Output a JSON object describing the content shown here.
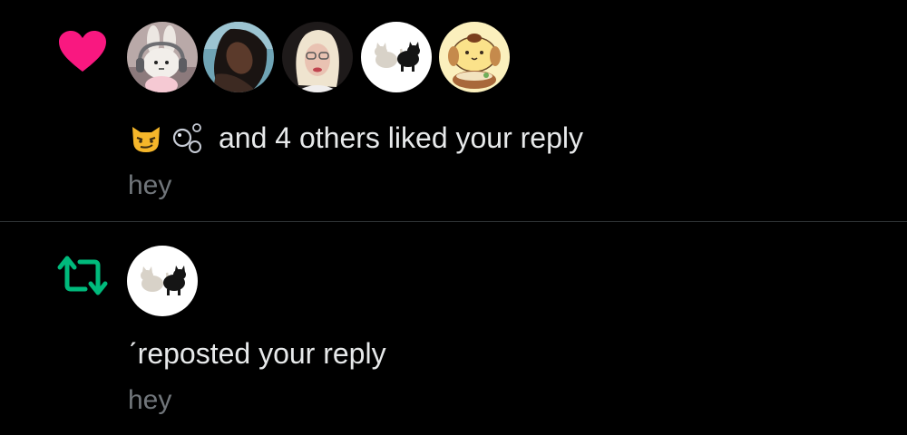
{
  "colors": {
    "background": "#000000",
    "primary_text": "#e7e9ea",
    "secondary_text": "#71767b",
    "like": "#f91880",
    "repost": "#00ba7c",
    "divider": "#2f3336"
  },
  "like_notification": {
    "icon": "heart-icon",
    "avatars": [
      "avatar-bunny",
      "avatar-woman-dark",
      "avatar-woman-blonde",
      "avatar-cats",
      "avatar-pompompurin"
    ],
    "name_emojis": [
      "smirking-cat-emoji",
      "bubbles-emoji"
    ],
    "text": "and 4 others liked your reply",
    "snippet": "hey"
  },
  "repost_notification": {
    "icon": "repost-icon",
    "avatars": [
      "avatar-cats"
    ],
    "prefix": "ˊ",
    "text": "reposted your reply",
    "snippet": "hey"
  }
}
